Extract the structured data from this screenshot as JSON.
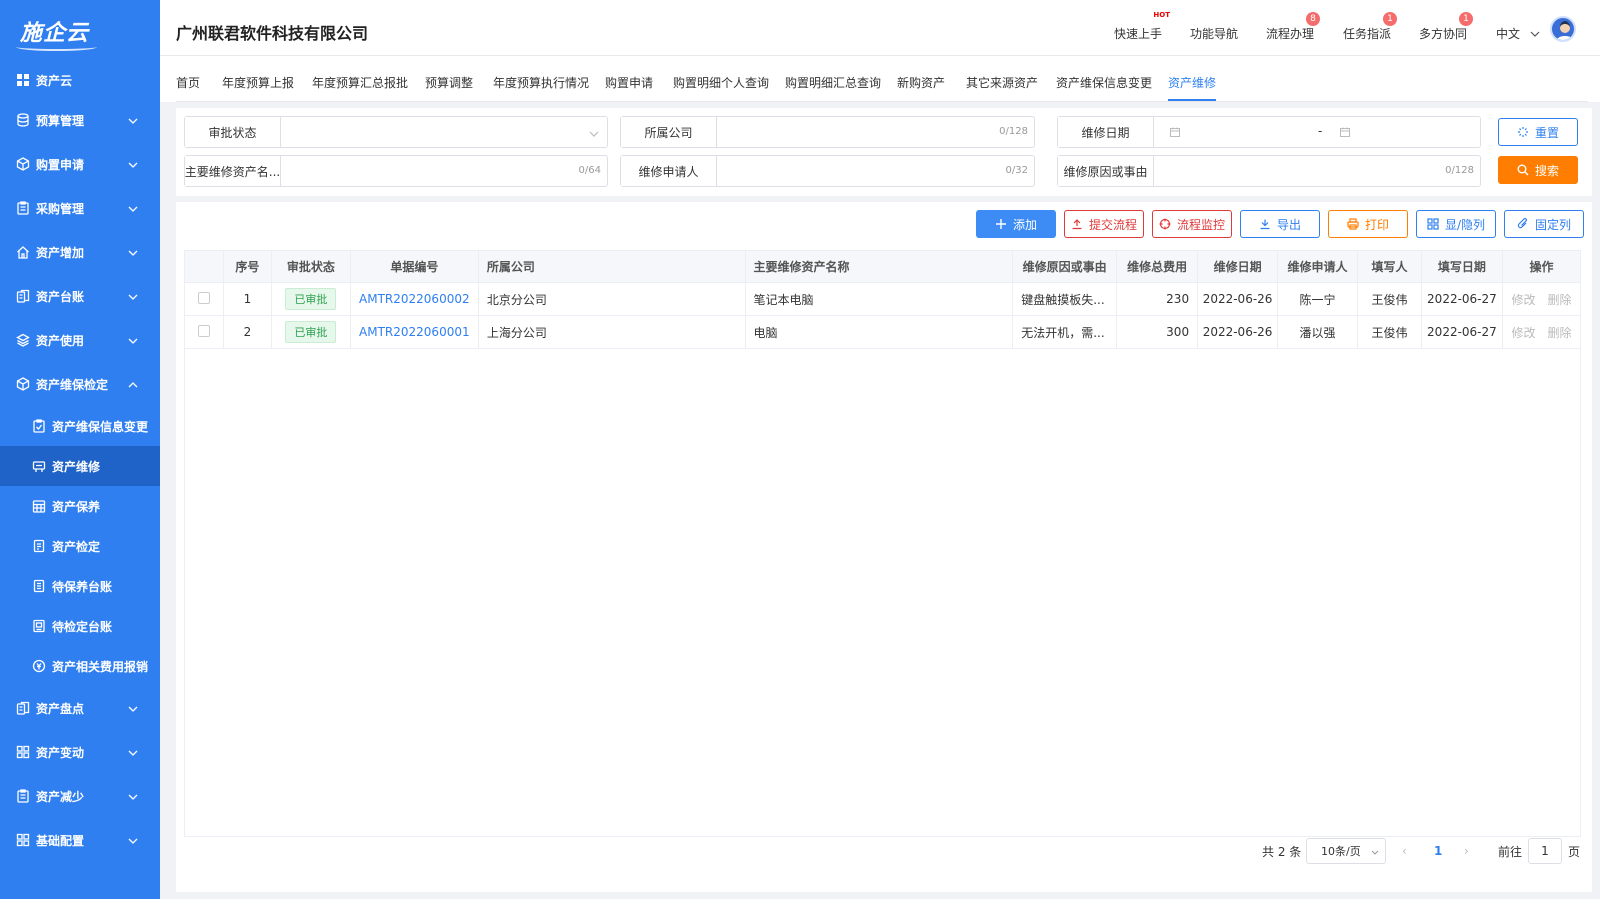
{
  "sidebar": {
    "logo": "施企云",
    "items": [
      {
        "label": "资产云",
        "icon": "grid-icon"
      },
      {
        "label": "预算管理",
        "icon": "database-icon"
      },
      {
        "label": "购置申请",
        "icon": "cube-icon"
      },
      {
        "label": "采购管理",
        "icon": "clipboard-icon"
      },
      {
        "label": "资产增加",
        "icon": "home-icon"
      },
      {
        "label": "资产台账",
        "icon": "ledger-icon"
      },
      {
        "label": "资产使用",
        "icon": "layers-icon"
      },
      {
        "label": "资产维保检定",
        "icon": "cube-icon"
      }
    ],
    "sub_items": [
      {
        "label": "资产维保信息变更",
        "icon": "check-doc-icon"
      },
      {
        "label": "资产维修",
        "icon": "repair-icon"
      },
      {
        "label": "资产保养",
        "icon": "calendar-grid-icon"
      },
      {
        "label": "资产检定",
        "icon": "doc-icon"
      },
      {
        "label": "待保养台账",
        "icon": "list-doc-icon"
      },
      {
        "label": "待检定台账",
        "icon": "image-doc-icon"
      },
      {
        "label": "资产相关费用报销",
        "icon": "coin-icon"
      }
    ],
    "bottom_items": [
      {
        "label": "资产盘点",
        "icon": "ledger-icon"
      },
      {
        "label": "资产变动",
        "icon": "apps-icon"
      },
      {
        "label": "资产减少",
        "icon": "clipboard-icon"
      },
      {
        "label": "基础配置",
        "icon": "apps-icon"
      }
    ]
  },
  "header": {
    "company": "广州联君软件科技有限公司",
    "nav": [
      {
        "label": "快速上手",
        "badge": "HOT"
      },
      {
        "label": "功能导航",
        "badge": ""
      },
      {
        "label": "流程办理",
        "badge": "8"
      },
      {
        "label": "任务指派",
        "badge": "1"
      },
      {
        "label": "多方协同",
        "badge": "1"
      }
    ],
    "language": "中文"
  },
  "tabs": [
    "首页",
    "年度预算上报",
    "年度预算汇总报批",
    "预算调整",
    "年度预算执行情况",
    "购置申请",
    "购置明细个人查询",
    "购置明细汇总查询",
    "新购资产",
    "其它来源资产",
    "资产维保信息变更",
    "资产维修"
  ],
  "active_tab": "资产维修",
  "filters": {
    "approval_status": {
      "label": "审批状态",
      "value": ""
    },
    "company": {
      "label": "所属公司",
      "count": "0/128"
    },
    "repair_date": {
      "label": "维修日期",
      "separator": "-"
    },
    "asset_name": {
      "label": "主要维修资产名...",
      "count": "0/64"
    },
    "applicant": {
      "label": "维修申请人",
      "count": "0/32"
    },
    "reason": {
      "label": "维修原因或事由",
      "count": "0/128"
    },
    "reset_label": "重置",
    "search_label": "搜索"
  },
  "toolbar": {
    "add": "添加",
    "submit": "提交流程",
    "monitor": "流程监控",
    "export": "导出",
    "print": "打印",
    "toggle_cols": "显/隐列",
    "fix_cols": "固定列"
  },
  "table": {
    "headers": [
      "序号",
      "审批状态",
      "单据编号",
      "所属公司",
      "主要维修资产名称",
      "维修原因或事由",
      "维修总费用",
      "维修日期",
      "维修申请人",
      "填写人",
      "填写日期",
      "操作"
    ],
    "rows": [
      {
        "no": "1",
        "status": "已审批",
        "code": "AMTR2022060002",
        "company": "北京分公司",
        "asset": "笔记本电脑",
        "reason": "键盘触摸板失...",
        "cost": "230",
        "date": "2022-06-26",
        "applicant": "陈一宁",
        "filler": "王俊伟",
        "fill_date": "2022-06-27"
      },
      {
        "no": "2",
        "status": "已审批",
        "code": "AMTR2022060001",
        "company": "上海分公司",
        "asset": "电脑",
        "reason": "无法开机，需...",
        "cost": "300",
        "date": "2022-06-26",
        "applicant": "潘以强",
        "filler": "王俊伟",
        "fill_date": "2022-06-27"
      }
    ],
    "op_edit": "修改",
    "op_delete": "删除"
  },
  "pagination": {
    "total": "共 2 条",
    "page_size": "10条/页",
    "current": "1",
    "goto_prefix": "前往",
    "goto_value": "1",
    "goto_suffix": "页"
  },
  "colors": {
    "primary": "#2f7ff0",
    "sidebar_active": "#1f63c9",
    "search": "#ff7d00",
    "danger": "#e03b3b",
    "warning": "#ff7d00",
    "success": "#2fa24e"
  }
}
